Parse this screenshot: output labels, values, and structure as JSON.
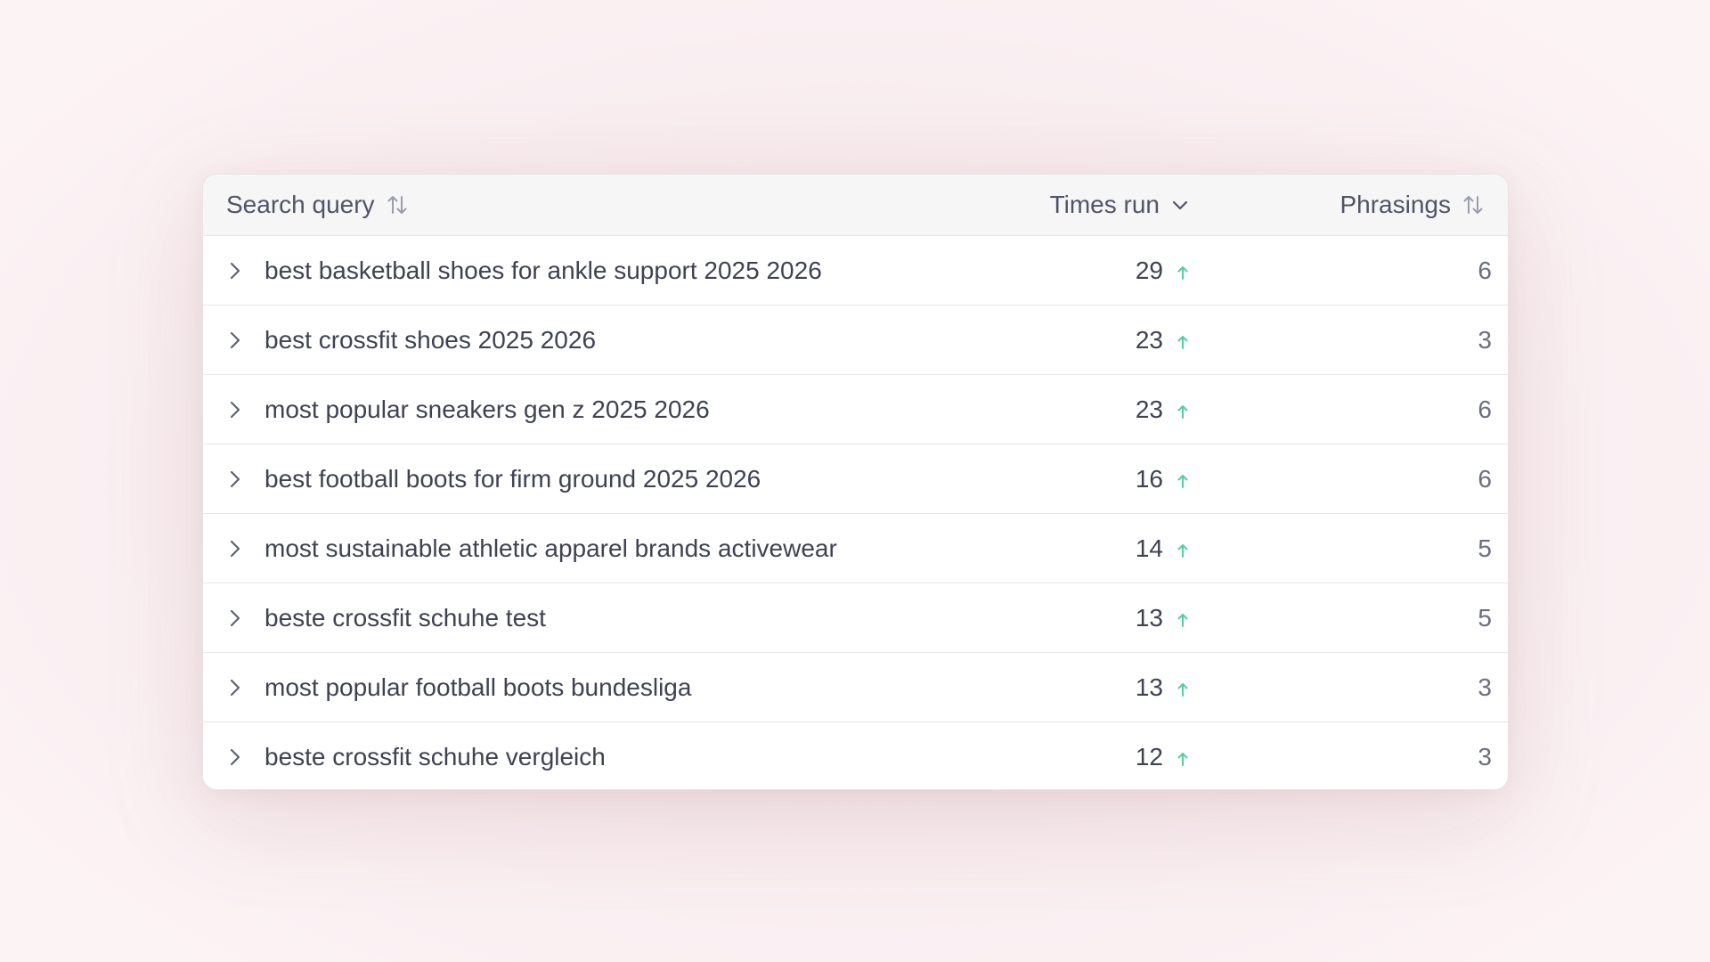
{
  "colors": {
    "trend_up": "#58cc9e",
    "text_primary": "#3f4253",
    "header_text": "#515466",
    "header_background": "#f6f6f7"
  },
  "table": {
    "columns": {
      "query": {
        "label": "Search query",
        "sort_icon": "sort-both-icon"
      },
      "times_run": {
        "label": "Times run",
        "sort_icon": "chevron-down-icon",
        "sorted": "descending"
      },
      "phrasings": {
        "label": "Phrasings",
        "sort_icon": "sort-both-icon"
      }
    },
    "rows": [
      {
        "query": "best basketball shoes for ankle support 2025 2026",
        "times_run": "29",
        "trend": "up",
        "phrasings": "6"
      },
      {
        "query": "best crossfit shoes 2025 2026",
        "times_run": "23",
        "trend": "up",
        "phrasings": "3"
      },
      {
        "query": "most popular sneakers gen z 2025 2026",
        "times_run": "23",
        "trend": "up",
        "phrasings": "6"
      },
      {
        "query": "best football boots for firm ground 2025 2026",
        "times_run": "16",
        "trend": "up",
        "phrasings": "6"
      },
      {
        "query": "most sustainable athletic apparel brands activewear",
        "times_run": "14",
        "trend": "up",
        "phrasings": "5"
      },
      {
        "query": "beste crossfit schuhe test",
        "times_run": "13",
        "trend": "up",
        "phrasings": "5"
      },
      {
        "query": "most popular football boots bundesliga",
        "times_run": "13",
        "trend": "up",
        "phrasings": "3"
      },
      {
        "query": "beste crossfit schuhe vergleich",
        "times_run": "12",
        "trend": "up",
        "phrasings": "3"
      }
    ]
  }
}
